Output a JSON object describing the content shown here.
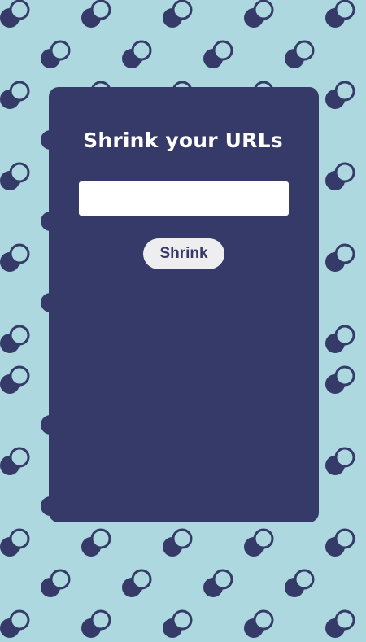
{
  "app": {
    "title": "Shrink your URLs"
  },
  "form": {
    "url_input": {
      "value": "",
      "placeholder": ""
    },
    "submit_label": "Shrink"
  },
  "theme": {
    "background_color": "#add8df",
    "card_color": "#353a68",
    "pattern_color": "#353a68",
    "input_color": "#ffffff",
    "button_color": "#eeeef1",
    "button_text_color": "#353a68",
    "title_color": "#ffffff"
  },
  "decoration": {
    "pattern_icon": "overlapping-circles-icon"
  }
}
